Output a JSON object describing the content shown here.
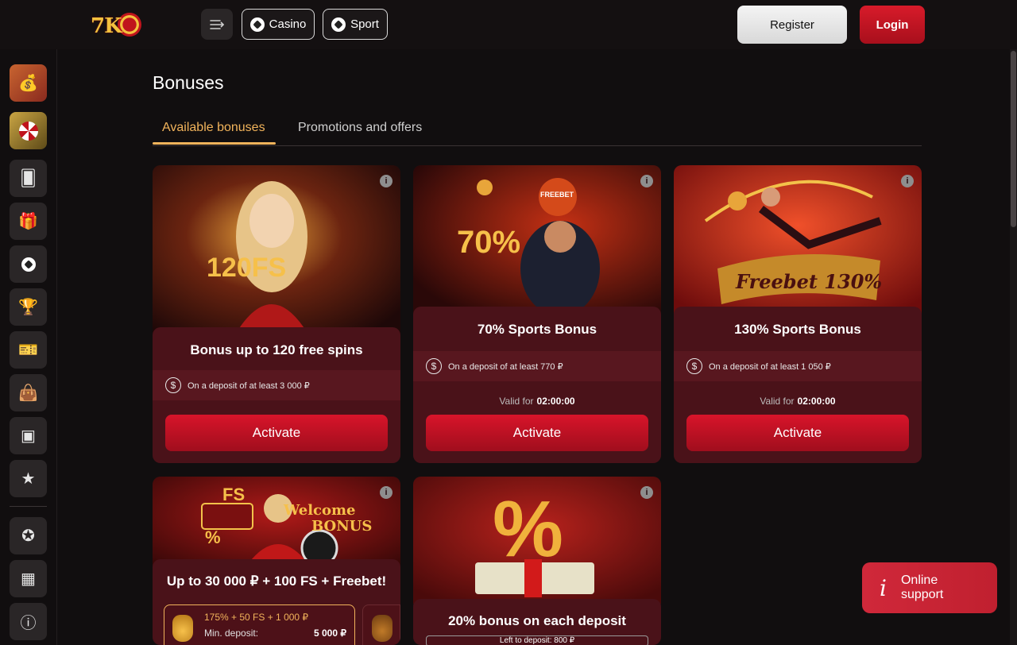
{
  "header": {
    "logo_text": "7K",
    "casino_label": "Casino",
    "sport_label": "Sport",
    "register_label": "Register",
    "login_label": "Login"
  },
  "sidebar": {
    "items": [
      "bonus-bag-icon",
      "wheel-icon",
      "cards-icon",
      "gift-icon",
      "soccer-ball-icon",
      "trophy-icon",
      "ticket-icon",
      "shop-bag-icon",
      "box-icon",
      "calendar-star-icon",
      "badge-icon",
      "calendar-icon",
      "info-icon"
    ]
  },
  "page": {
    "title": "Bonuses",
    "tabs": [
      {
        "label": "Available bonuses",
        "active": true
      },
      {
        "label": "Promotions and offers",
        "active": false
      }
    ]
  },
  "cards": [
    {
      "art_text": "120FS",
      "title": "Bonus up to 120 free spins",
      "deposit": "On a deposit of at least 3 000 ₽",
      "button": "Activate"
    },
    {
      "art_text": "70%",
      "art_badge": "FREEBET",
      "title": "70% Sports Bonus",
      "deposit": "On a deposit of at least 770 ₽",
      "valid_label": "Valid for",
      "valid_time": "02:00:00",
      "button": "Activate"
    },
    {
      "art_text": "Freebet 130%",
      "title": "130% Sports Bonus",
      "deposit": "On a deposit of at least 1 050 ₽",
      "valid_label": "Valid for",
      "valid_time": "02:00:00",
      "button": "Activate"
    },
    {
      "art_text_1": "FS",
      "art_text_2": "Welcome",
      "art_text_3": "BONUS",
      "art_text_4": "%",
      "title": "Up to 30 000 ₽ + 100 FS + Freebet!",
      "offer_line1": "175% + 50 FS + 1 000 ₽",
      "offer_line2": "Min. deposit:",
      "offer_amount": "5 000 ₽"
    },
    {
      "art_text": "%",
      "title": "20% bonus on each deposit",
      "left_deposit": "Left to deposit: 800 ₽"
    }
  ],
  "support": {
    "icon": "i",
    "label": "Online support"
  },
  "colors": {
    "accent": "#f1b35b",
    "primary": "#d8142a",
    "bg": "#110e0f"
  }
}
